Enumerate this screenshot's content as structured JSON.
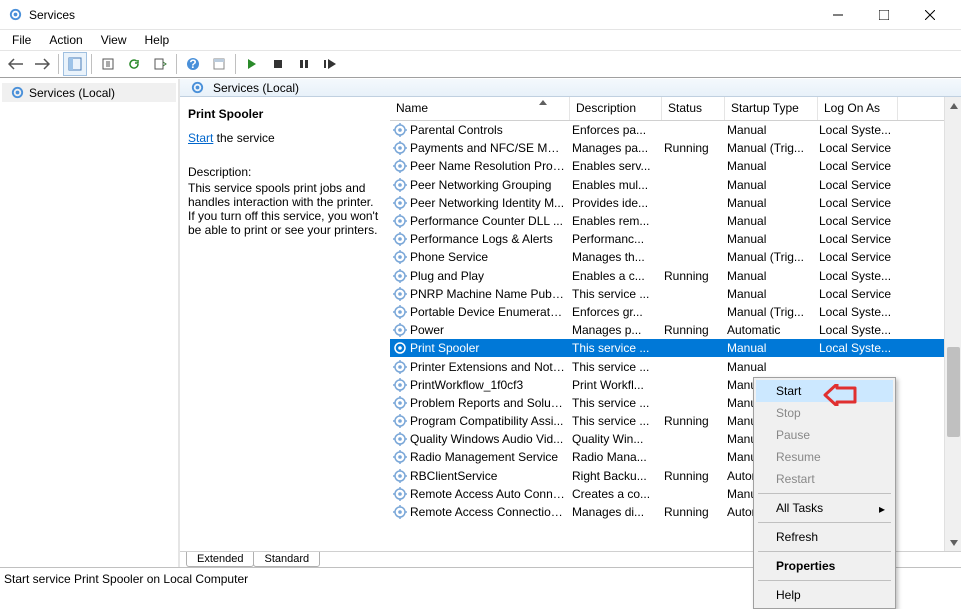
{
  "window": {
    "title": "Services"
  },
  "menu": {
    "file": "File",
    "action": "Action",
    "view": "View",
    "help": "Help"
  },
  "tree": {
    "root": "Services (Local)"
  },
  "header": {
    "title": "Services (Local)"
  },
  "details": {
    "name": "Print Spooler",
    "start_link": "Start",
    "start_suffix": " the service",
    "desc_label": "Description:",
    "desc_text": "This service spools print jobs and handles interaction with the printer. If you turn off this service, you won't be able to print or see your printers."
  },
  "columns": {
    "name": "Name",
    "desc": "Description",
    "status": "Status",
    "startup": "Startup Type",
    "logon": "Log On As"
  },
  "rows": [
    {
      "name": "Parental Controls",
      "desc": "Enforces pa...",
      "status": "",
      "startup": "Manual",
      "logon": "Local Syste..."
    },
    {
      "name": "Payments and NFC/SE Man...",
      "desc": "Manages pa...",
      "status": "Running",
      "startup": "Manual (Trig...",
      "logon": "Local Service"
    },
    {
      "name": "Peer Name Resolution Prot...",
      "desc": "Enables serv...",
      "status": "",
      "startup": "Manual",
      "logon": "Local Service"
    },
    {
      "name": "Peer Networking Grouping",
      "desc": "Enables mul...",
      "status": "",
      "startup": "Manual",
      "logon": "Local Service"
    },
    {
      "name": "Peer Networking Identity M...",
      "desc": "Provides ide...",
      "status": "",
      "startup": "Manual",
      "logon": "Local Service"
    },
    {
      "name": "Performance Counter DLL ...",
      "desc": "Enables rem...",
      "status": "",
      "startup": "Manual",
      "logon": "Local Service"
    },
    {
      "name": "Performance Logs & Alerts",
      "desc": "Performanc...",
      "status": "",
      "startup": "Manual",
      "logon": "Local Service"
    },
    {
      "name": "Phone Service",
      "desc": "Manages th...",
      "status": "",
      "startup": "Manual (Trig...",
      "logon": "Local Service"
    },
    {
      "name": "Plug and Play",
      "desc": "Enables a c...",
      "status": "Running",
      "startup": "Manual",
      "logon": "Local Syste..."
    },
    {
      "name": "PNRP Machine Name Publi...",
      "desc": "This service ...",
      "status": "",
      "startup": "Manual",
      "logon": "Local Service"
    },
    {
      "name": "Portable Device Enumerator...",
      "desc": "Enforces gr...",
      "status": "",
      "startup": "Manual (Trig...",
      "logon": "Local Syste..."
    },
    {
      "name": "Power",
      "desc": "Manages p...",
      "status": "Running",
      "startup": "Automatic",
      "logon": "Local Syste..."
    },
    {
      "name": "Print Spooler",
      "desc": "This service ...",
      "status": "",
      "startup": "Manual",
      "logon": "Local Syste...",
      "selected": true
    },
    {
      "name": "Printer Extensions and Notif...",
      "desc": "This service ...",
      "status": "",
      "startup": "Manual",
      "logon": ""
    },
    {
      "name": "PrintWorkflow_1f0cf3",
      "desc": "Print Workfl...",
      "status": "",
      "startup": "Manual",
      "logon": ""
    },
    {
      "name": "Problem Reports and Soluti...",
      "desc": "This service ...",
      "status": "",
      "startup": "Manual",
      "logon": ""
    },
    {
      "name": "Program Compatibility Assi...",
      "desc": "This service ...",
      "status": "Running",
      "startup": "Manual",
      "logon": ""
    },
    {
      "name": "Quality Windows Audio Vid...",
      "desc": "Quality Win...",
      "status": "",
      "startup": "Manual",
      "logon": ""
    },
    {
      "name": "Radio Management Service",
      "desc": "Radio Mana...",
      "status": "",
      "startup": "Manual",
      "logon": ""
    },
    {
      "name": "RBClientService",
      "desc": "Right Backu...",
      "status": "Running",
      "startup": "Automatic",
      "logon": ""
    },
    {
      "name": "Remote Access Auto Conne...",
      "desc": "Creates a co...",
      "status": "",
      "startup": "Manual",
      "logon": ""
    },
    {
      "name": "Remote Access Connection...",
      "desc": "Manages di...",
      "status": "Running",
      "startup": "Automatic",
      "logon": ""
    }
  ],
  "tabs": {
    "extended": "Extended",
    "standard": "Standard"
  },
  "statusbar": {
    "text": "Start service Print Spooler on Local Computer"
  },
  "context_menu": {
    "start": "Start",
    "stop": "Stop",
    "pause": "Pause",
    "resume": "Resume",
    "restart": "Restart",
    "all_tasks": "All Tasks",
    "refresh": "Refresh",
    "properties": "Properties",
    "help": "Help"
  }
}
